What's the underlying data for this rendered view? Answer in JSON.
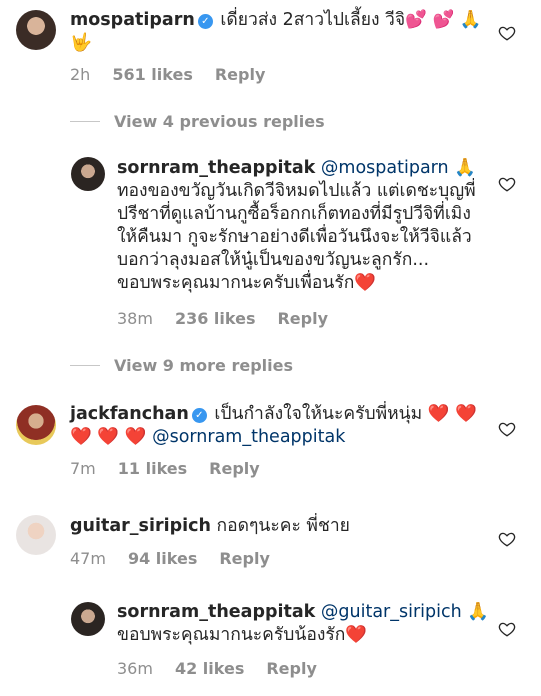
{
  "comments": [
    {
      "username": "mospatiparn",
      "verified": true,
      "text": "เดี่ยวส่ง 2สาวไปเลี้ยง วีจิ",
      "emoji_tail": "💕 💕 🙏",
      "emoji_line2": "🤟",
      "time": "2h",
      "likes": "561 likes",
      "reply_label": "Reply"
    },
    {
      "username": "sornram_theappitak",
      "mention": "@mospatiparn",
      "mention_emoji": "🙏",
      "lines": [
        "ทองของขวัญวันเกิดวีจิหมดไปแล้ว แต่เดชะบุญพี่",
        "ปรีชาที่ดูแลบ้านกูซื้อร็อกกเก็ตทองที่มีรูปวีจิที่เมิง",
        "ให้คืนมา กูจะรักษาอย่างดีเพื่อวันนึงจะให้วีจิแล้ว",
        "บอกว่าลุงมอสให้นู๋เป็นของขวัญนะลูกรัก...",
        "ขอบพระคุณมากนะครับเพื่อนรัก"
      ],
      "end_emoji": "❤️",
      "time": "38m",
      "likes": "236 likes",
      "reply_label": "Reply"
    },
    {
      "username": "jackfanchan",
      "verified": true,
      "text": "เป็นกำลังใจให้นะครับพี่หนุ่ม",
      "line1_emoji": "❤️ ❤️",
      "line2_emoji": "❤️ ❤️ ❤️",
      "mention": "@sornram_theappitak",
      "time": "7m",
      "likes": "11 likes",
      "reply_label": "Reply"
    },
    {
      "username": "guitar_siripich",
      "text": "กอดๆนะคะ พี่ชาย",
      "time": "47m",
      "likes": "94 likes",
      "reply_label": "Reply"
    },
    {
      "username": "sornram_theappitak",
      "mention": "@guitar_siripich",
      "mention_emoji": "🙏",
      "text": "ขอบพระคุณมากนะครับน้องรัก",
      "end_emoji": "❤️",
      "time": "36m",
      "likes": "42 likes",
      "reply_label": "Reply"
    }
  ],
  "view_previous": "View 4 previous replies",
  "view_more": "View 9 more replies"
}
